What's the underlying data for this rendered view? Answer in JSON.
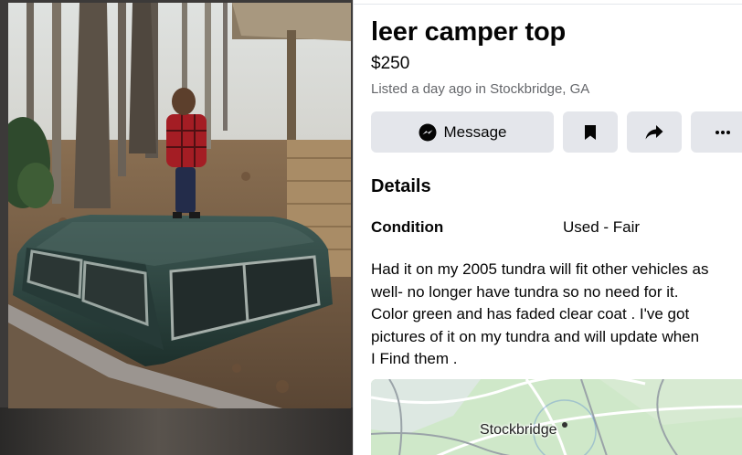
{
  "listing": {
    "title": "leer camper top",
    "price": "$250",
    "meta": "Listed a day ago in Stockbridge, GA"
  },
  "actions": {
    "message_label": "Message",
    "message_icon": "messenger-icon",
    "save_icon": "bookmark-icon",
    "share_icon": "share-arrow-icon",
    "more_label": "···"
  },
  "details": {
    "heading": "Details",
    "condition_label": "Condition",
    "condition_value": "Used - Fair",
    "description_lines": [
      "Had it on my 2005 tundra will fit other vehicles as",
      "well- no longer have tundra so no need for it.",
      "Color green and has faded clear coat . I've got",
      "pictures of it on my tundra and will update when",
      "I Find them ."
    ]
  },
  "map": {
    "place_label": "Stockbridge"
  },
  "colors": {
    "button_bg": "#e4e6eb",
    "secondary_text": "#65676b",
    "map_green": "#c8e6c2"
  }
}
